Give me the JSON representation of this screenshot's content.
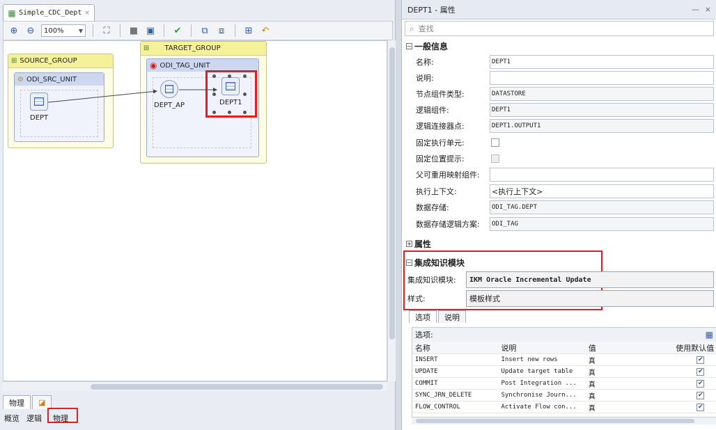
{
  "editor": {
    "tab_title": "Simple_CDC_Dept",
    "tab_close": "×",
    "zoom": "100%",
    "bottom_tabs": [
      "物理"
    ],
    "view_tabs": [
      "概览",
      "逻辑",
      "物理"
    ]
  },
  "diagram": {
    "source_group": "SOURCE_GROUP",
    "target_group": "TARGET_GROUP",
    "src_unit": "ODI_SRC_UNIT",
    "tag_unit": "ODI_TAG_UNIT",
    "node_dept": "DEPT",
    "node_dept_ap": "DEPT_AP",
    "node_dept1": "DEPT1"
  },
  "properties": {
    "title": "DEPT1 - 属性",
    "search_placeholder": "查找",
    "general_section": "一般信息",
    "rows": [
      {
        "label": "名称:",
        "value": "DEPT1"
      },
      {
        "label": "说明:",
        "value": ""
      },
      {
        "label": "节点组件类型:",
        "value": "DATASTORE"
      },
      {
        "label": "逻辑组件:",
        "value": "DEPT1"
      },
      {
        "label": "逻辑连接器点:",
        "value": "DEPT1.OUTPUT1"
      },
      {
        "label": "固定执行单元:",
        "value": ""
      },
      {
        "label": "固定位置提示:",
        "value": ""
      },
      {
        "label": "父可重用映射组件:",
        "value": ""
      },
      {
        "label": "执行上下文:",
        "value": "<执行上下文>"
      },
      {
        "label": "数据存储:",
        "value": "ODI_TAG.DEPT"
      },
      {
        "label": "数据存储逻辑方案:",
        "value": "ODI_TAG"
      }
    ],
    "attributes_section": "属性",
    "km_section": "集成知识模块",
    "km_label": "集成知识模块:",
    "km_value": "IKM Oracle Incremental Update",
    "style_label": "样式:",
    "style_value": "模板样式",
    "option_tabs": [
      "选项",
      "说明"
    ],
    "options_caption": "选项:",
    "option_headers": [
      "名称",
      "说明",
      "值",
      "使用默认值"
    ],
    "options": [
      {
        "name": "INSERT",
        "desc": "Insert new rows",
        "value": "真"
      },
      {
        "name": "UPDATE",
        "desc": "Update target table",
        "value": "真"
      },
      {
        "name": "COMMIT",
        "desc": "Post Integration ...",
        "value": "真"
      },
      {
        "name": "SYNC_JRN_DELETE",
        "desc": "Synchronise Journ...",
        "value": "真"
      },
      {
        "name": "FLOW_CONTROL",
        "desc": "Activate Flow con...",
        "value": "真"
      }
    ]
  }
}
